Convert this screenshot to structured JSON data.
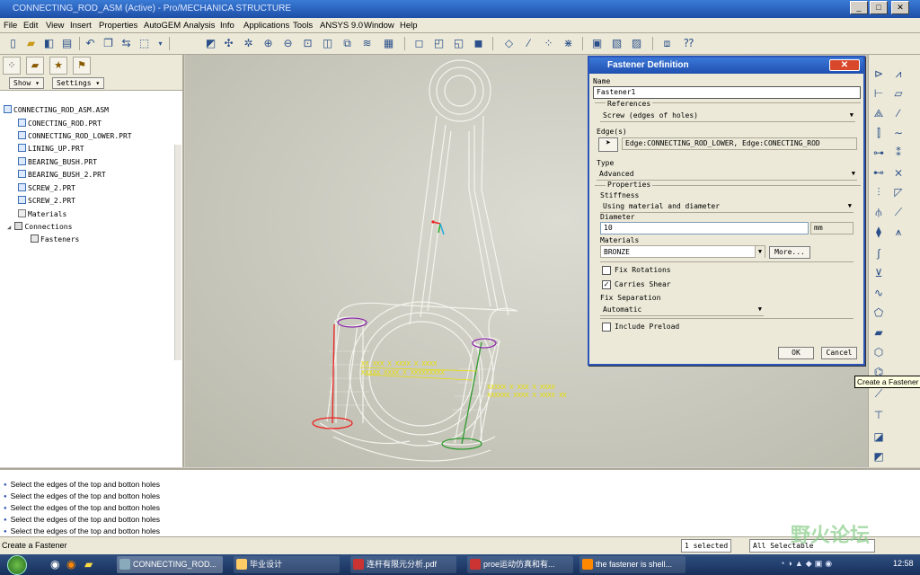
{
  "window": {
    "title": "CONNECTING_ROD_ASM (Active) - Pro/MECHANICA STRUCTURE",
    "min": "_",
    "max": "□",
    "close": "✕"
  },
  "menu": [
    "File",
    "Edit",
    "View",
    "Insert",
    "Properties",
    "AutoGEM",
    "Analysis",
    "Info",
    "Applications",
    "Tools",
    "ANSYS 9.0",
    "Window",
    "Help"
  ],
  "left_panel": {
    "show_btn": "Show ▾",
    "settings_btn": "Settings ▾",
    "tree": [
      {
        "label": "CONNECTING_ROD_ASM.ASM",
        "level": 0
      },
      {
        "label": "CONECTING_ROD.PRT",
        "level": 1
      },
      {
        "label": "CONNECTING_ROD_LOWER.PRT",
        "level": 1
      },
      {
        "label": "LINING_UP.PRT",
        "level": 1
      },
      {
        "label": "BEARING_BUSH.PRT",
        "level": 1
      },
      {
        "label": "BEARING_BUSH_2.PRT",
        "level": 1
      },
      {
        "label": "SCREW_2.PRT",
        "level": 1
      },
      {
        "label": "SCREW_2.PRT",
        "level": 1
      },
      {
        "label": "Materials",
        "level": 1
      },
      {
        "label": "Connections",
        "level": 1
      },
      {
        "label": "Fasteners",
        "level": 2
      }
    ]
  },
  "dialog": {
    "title": "Fastener Definition",
    "close": "✕",
    "name_label": "Name",
    "name_value": "Fastener1",
    "references_label": "References",
    "references_value": "Screw (edges of holes)",
    "edges_label": "Edge(s)",
    "edges_value": "Edge:CONNECTING_ROD_LOWER, Edge:CONECTING_ROD",
    "type_label": "Type",
    "type_value": "Advanced",
    "properties_label": "Properties",
    "stiffness_label": "Stiffness",
    "stiffness_value": "Using material and diameter",
    "diameter_label": "Diameter",
    "diameter_value": "10",
    "diameter_unit": "mm",
    "materials_label": "Materials",
    "materials_value": "BRONZE",
    "more_btn": "More...",
    "fix_rotations": "Fix Rotations",
    "fix_rotations_checked": false,
    "carries_shear": "Carries Shear",
    "carries_shear_checked": true,
    "fix_separation_label": "Fix Separation",
    "fix_separation_value": "Automatic",
    "include_preload": "Include Preload",
    "include_preload_checked": false,
    "ok": "OK",
    "cancel": "Cancel"
  },
  "tooltip": "Create a Fastener",
  "messages": [
    "Select the edges of the top and botton holes",
    "Select the edges of the top and botton holes",
    "Select the edges of the top and botton holes",
    "Select the edges of the top and botton holes",
    "Select the edges of the top and botton holes"
  ],
  "status": {
    "left": "Create a Fastener",
    "selected": "1 selected",
    "filter": "All Selectable"
  },
  "watermark": "野火论坛",
  "taskbar": {
    "items": [
      "CONNECTING_ROD...",
      "毕业设计",
      "连杆有限元分析.pdf",
      "proe运动仿真和有...",
      "the fastener is shell..."
    ],
    "clock": "12:58"
  },
  "colors": {
    "title_blue": "#2050b0",
    "tooltip_bg": "#ffffe1",
    "annotation_yellow": "#e8e000"
  }
}
